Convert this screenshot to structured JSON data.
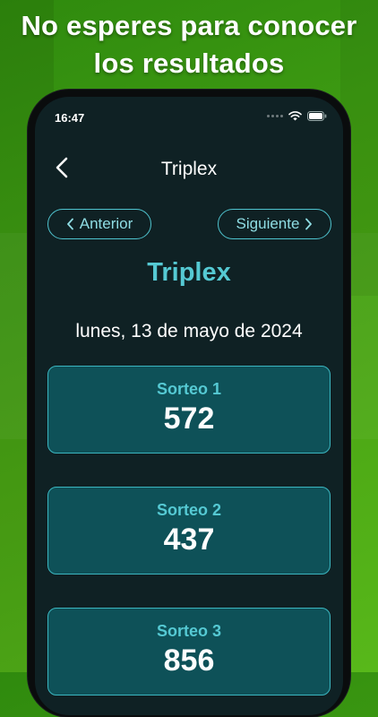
{
  "promo": {
    "line1": "No esperes para conocer",
    "line2": "los resultados"
  },
  "status_bar": {
    "time": "16:47",
    "icons": [
      "signal-dots-icon",
      "wifi-icon",
      "battery-icon"
    ]
  },
  "nav": {
    "back_icon": "chevron-left-icon",
    "title": "Triplex"
  },
  "pager": {
    "prev_label": "Anterior",
    "next_label": "Siguiente"
  },
  "game": {
    "name": "Triplex",
    "date": "lunes, 13 de mayo de 2024"
  },
  "draws": [
    {
      "label": "Sorteo 1",
      "number": "572"
    },
    {
      "label": "Sorteo 2",
      "number": "437"
    },
    {
      "label": "Sorteo 3",
      "number": "856"
    }
  ],
  "colors": {
    "accent": "#55c9d3",
    "card_bg": "#0e5158",
    "screen_bg": "#0f2124",
    "promo_bg": "#3d9a12"
  }
}
